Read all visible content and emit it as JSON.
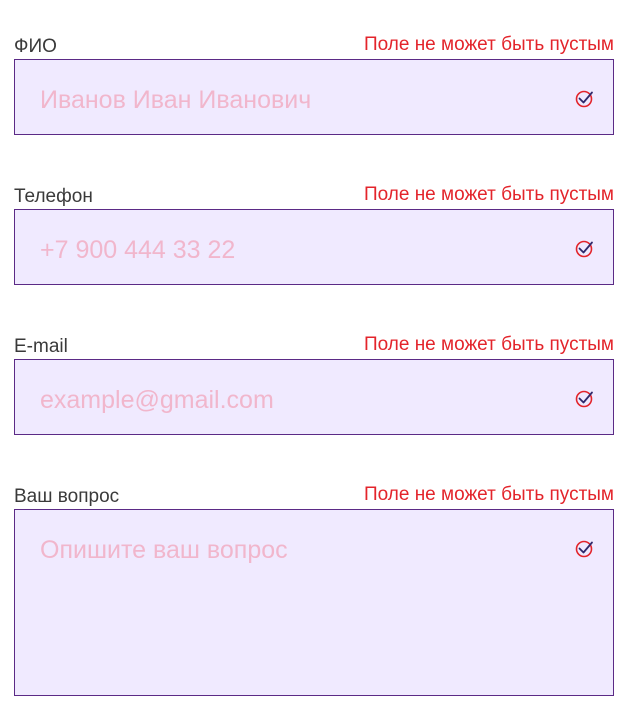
{
  "form": {
    "fields": [
      {
        "label": "ФИО",
        "error": "Поле не может быть пустым",
        "placeholder": "Иванов Иван Иванович",
        "icon": "check-circle-icon"
      },
      {
        "label": "Телефон",
        "error": "Поле не может быть пустым",
        "placeholder": "+7 900 444 33 22",
        "icon": "check-circle-icon"
      },
      {
        "label": "E-mail",
        "error": "Поле не может быть пустым",
        "placeholder": "example@gmail.com",
        "icon": "check-circle-icon"
      },
      {
        "label": "Ваш вопрос",
        "error": "Поле не может быть пустым",
        "placeholder": "Опишите ваш вопрос",
        "icon": "check-circle-icon"
      }
    ]
  },
  "colors": {
    "label": "#3a3a3a",
    "error": "#e3242b",
    "input_background": "#f0eaff",
    "input_border": "#5b2a86",
    "placeholder": "#f1b6cc"
  }
}
